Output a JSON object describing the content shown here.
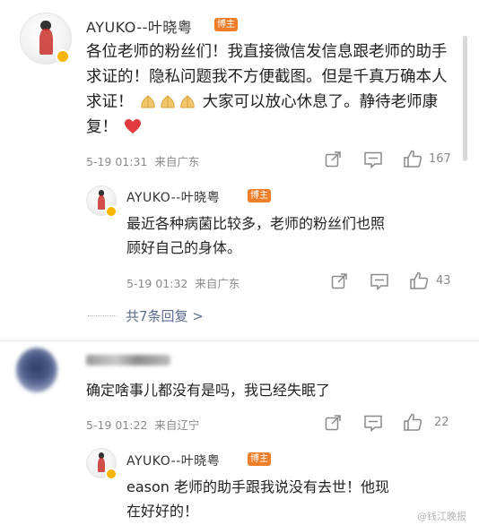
{
  "comments": [
    {
      "username": "AYUKO--叶晓粤",
      "badge": "博主",
      "text": "各位老师的粉丝们！我直接微信发信息跟老师的助手求证的！隐私问题我不方便截图。但是千真万确本人求证！",
      "text_tail": "大家可以放心休息了。静待老师康复！",
      "time": "5-19 01:31",
      "location": "来自广东",
      "likes": "167"
    },
    {
      "username": "AYUKO--叶晓粤",
      "badge": "博主",
      "text_line1": "最近各种病菌比较多，老师的粉丝们也照",
      "text_line2": "顾好自己的身体。",
      "time": "5-19 01:32",
      "location": "来自广东",
      "likes": "43"
    },
    {
      "text": "确定啥事儿都没有是吗，我已经失眠了",
      "time": "5-19 01:22",
      "location": "来自辽宁",
      "likes": "22"
    },
    {
      "username": "AYUKO--叶晓粤",
      "badge": "博主",
      "text_line1": "eason 老师的助手跟我说没有去世！他现",
      "text_line2": "在好好的！"
    }
  ],
  "thread_link": "共7条回复 >",
  "watermark": "@钱江晚报",
  "icons": [
    "share-icon",
    "comment-icon",
    "like-icon",
    "verified-icon",
    "folded-hands-emoji",
    "heart-emoji"
  ],
  "colors": {
    "badge": "#f07d2a",
    "verify": "#f7b500",
    "link": "#5d6d92",
    "heart": "#e23a3a"
  }
}
